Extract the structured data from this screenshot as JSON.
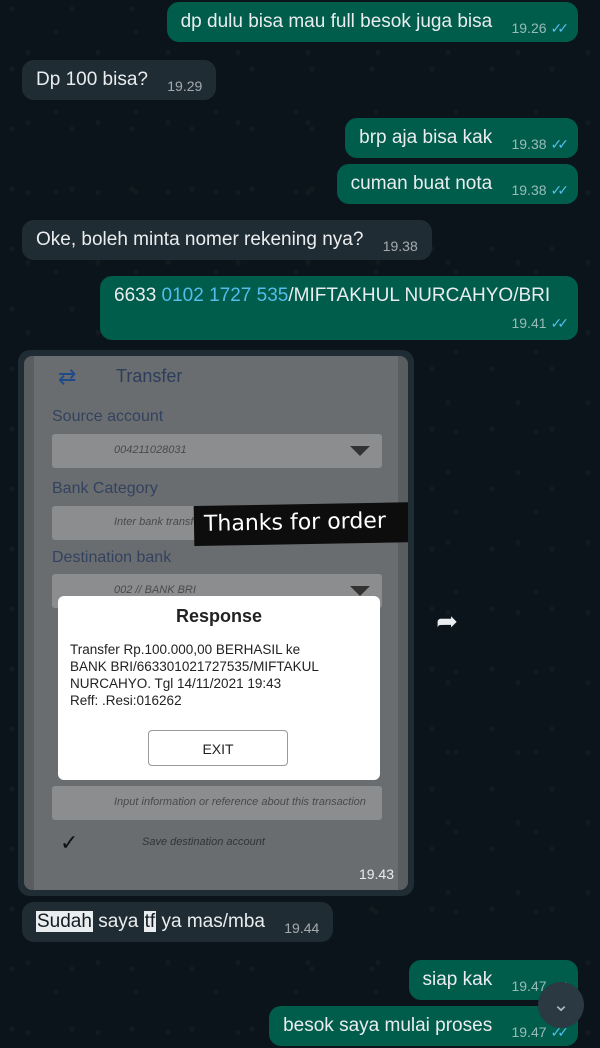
{
  "messages": [
    {
      "id": "m1",
      "dir": "out",
      "text": "dp dulu bisa mau full besok juga bisa",
      "time": "19.26",
      "read": true
    },
    {
      "id": "m2",
      "dir": "in",
      "text": "Dp 100 bisa?",
      "time": "19.29"
    },
    {
      "id": "m3",
      "dir": "out",
      "text": "brp aja bisa kak",
      "time": "19.38",
      "read": true
    },
    {
      "id": "m4",
      "dir": "out",
      "text": "cuman buat nota",
      "time": "19.38",
      "read": true
    },
    {
      "id": "m5",
      "dir": "in",
      "text": "Oke, boleh minta nomer rekening nya?",
      "time": "19.38"
    },
    {
      "id": "m6",
      "dir": "out",
      "prefix": "6633 ",
      "link": "0102 1727 535",
      "suffix": "/MIFTAKHUL NURCAHYO/BRI",
      "time": "19.41",
      "read": true
    },
    {
      "id": "m8",
      "dir": "in",
      "h1": "Sudah",
      "mid1": " saya ",
      "h2": "tf",
      "rest": " ya mas/mba",
      "time": "19.44"
    },
    {
      "id": "m9",
      "dir": "out",
      "text": "siap kak",
      "time": "19.47",
      "read": true
    },
    {
      "id": "m10",
      "dir": "out",
      "text": "besok saya mulai proses",
      "time": "19.47",
      "read": true
    }
  ],
  "image_message": {
    "time": "19.43",
    "screen_title": "Transfer",
    "source_label": "Source account",
    "source_value": "004211028031",
    "bank_category_label": "Bank Category",
    "bank_category_value": "Inter bank transfer",
    "destination_label": "Destination bank",
    "destination_value": "002 // BANK BRI",
    "info_placeholder": "Input information or reference about this transaction",
    "save_label": "Save destination account",
    "stamp": "Thanks for order",
    "dialog": {
      "title": "Response",
      "body_line1": "Transfer Rp.100.000,00 BERHASIL ke",
      "body_line2": "BANK BRI/663301021727535/MIFTAKUL",
      "body_line3": "NURCAHYO. Tgl 14/11/2021 19:43",
      "body_line4": "Reff: .Resi:016262",
      "button": "EXIT"
    }
  },
  "colors": {
    "background": "#0b141a",
    "outgoing_bubble": "#005c4b",
    "incoming_bubble": "#202c33",
    "read_ticks": "#53bdeb"
  },
  "icons": {
    "forward": "forward-arrow-icon",
    "scroll_down": "double-chevron-down-icon",
    "read_receipt": "double-check-icon"
  }
}
